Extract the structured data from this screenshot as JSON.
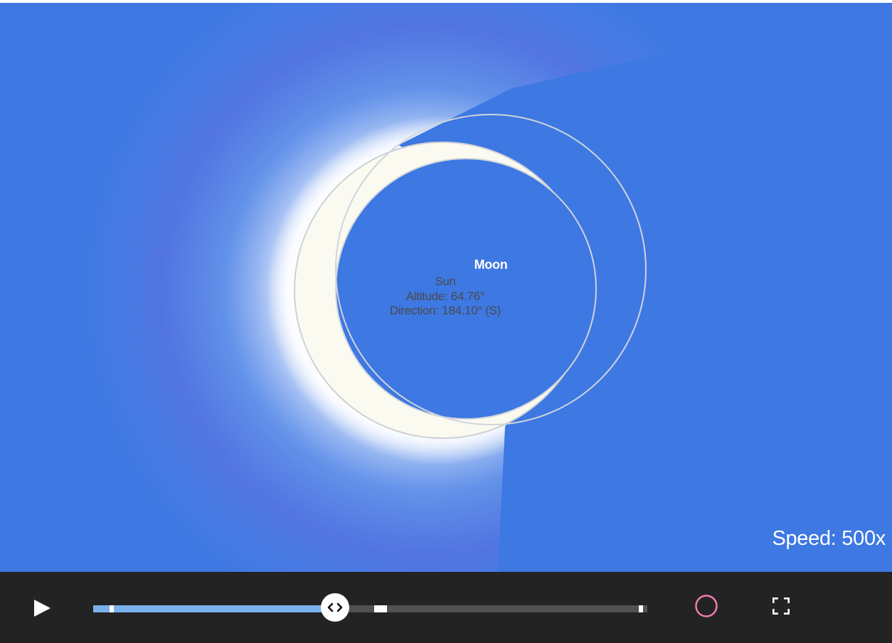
{
  "scene": {
    "sky_color": "#3d78e3",
    "moon_label": "Moon",
    "sun_label": "Sun",
    "sun_altitude": "Altitude: 64.76°",
    "sun_direction": "Direction: 184.10° (S)",
    "speed": "Speed: 500x",
    "sun_color": "#fbfaf0",
    "orbit_outline_color": "#d0d4dc"
  },
  "controls": {
    "play_icon": "play-icon",
    "timeline_progress": 0.436,
    "timeline_markers": [
      0.033,
      0.518,
      0.988
    ],
    "thumb_icon": "chevrons-left-right-icon",
    "record_icon": "circle-icon",
    "record_color": "#f07cb0",
    "fullscreen_icon": "fullscreen-icon",
    "track_color": "#515151",
    "progress_color": "#7bb0ec"
  }
}
